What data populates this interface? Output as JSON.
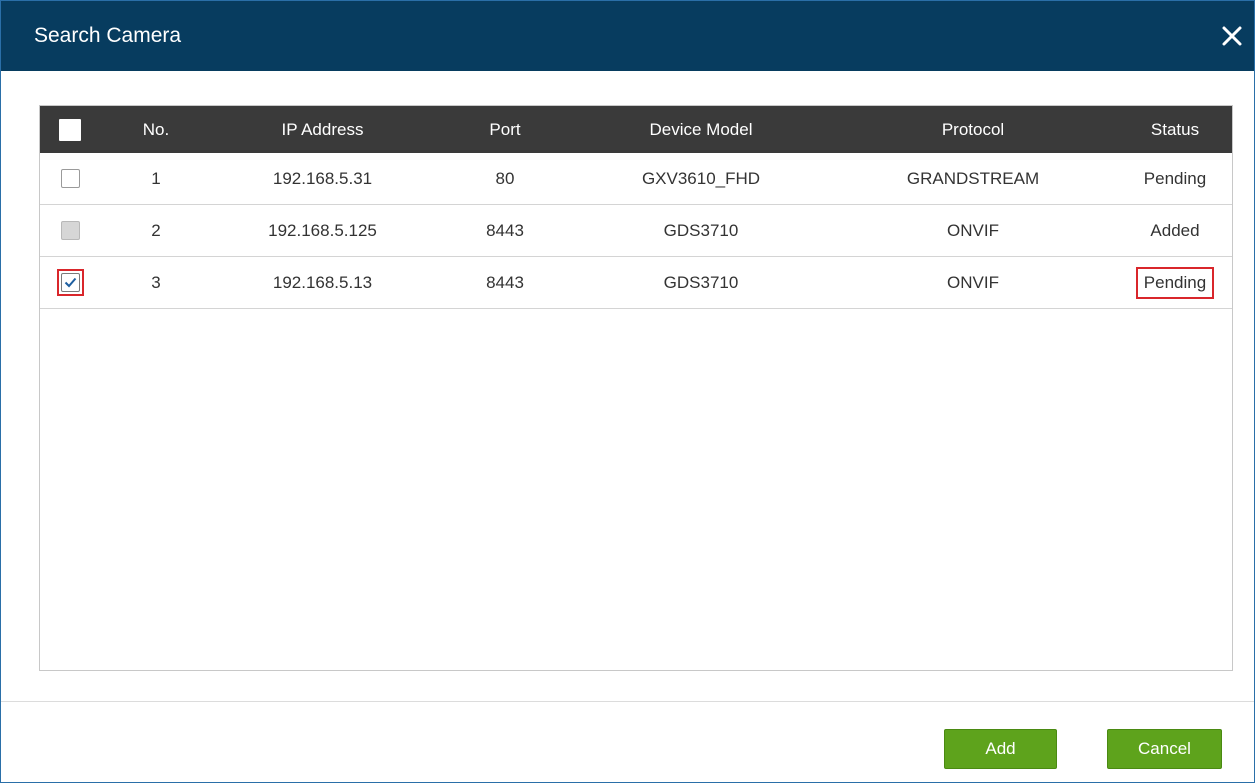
{
  "dialog": {
    "title": "Search Camera",
    "close_icon": "close-icon"
  },
  "table": {
    "columns": {
      "no": "No.",
      "ip": "IP Address",
      "port": "Port",
      "model": "Device Model",
      "protocol": "Protocol",
      "status": "Status"
    },
    "rows": [
      {
        "checked": false,
        "disabled": false,
        "no": "1",
        "ip": "192.168.5.31",
        "port": "80",
        "model": "GXV3610_FHD",
        "protocol": "GRANDSTREAM",
        "status": "Pending"
      },
      {
        "checked": false,
        "disabled": true,
        "no": "2",
        "ip": "192.168.5.125",
        "port": "8443",
        "model": "GDS3710",
        "protocol": "ONVIF",
        "status": "Added"
      },
      {
        "checked": true,
        "disabled": false,
        "no": "3",
        "ip": "192.168.5.13",
        "port": "8443",
        "model": "GDS3710",
        "protocol": "ONVIF",
        "status": "Pending"
      }
    ]
  },
  "buttons": {
    "add": "Add",
    "cancel": "Cancel"
  },
  "colors": {
    "titlebar": "#073c5f",
    "table_header": "#3a3a3a",
    "button_green": "#5ea31c",
    "highlight_red": "#d9262b"
  }
}
